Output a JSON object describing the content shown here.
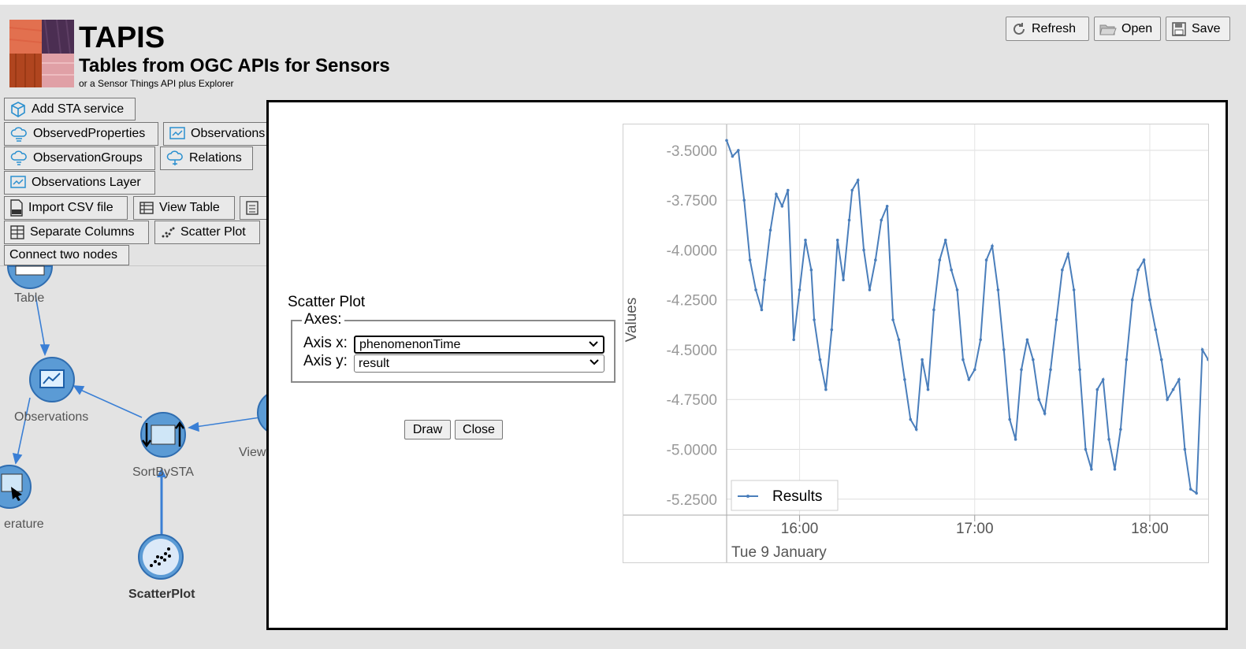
{
  "app": {
    "title": "TAPIS",
    "subtitle": "Tables from OGC APIs for Sensors",
    "tagline": "or a Sensor Things API plus Explorer"
  },
  "header_buttons": [
    {
      "label": "Refresh",
      "icon": "refresh-icon"
    },
    {
      "label": "Open",
      "icon": "folder-open-icon"
    },
    {
      "label": "Save",
      "icon": "floppy-disk-icon"
    }
  ],
  "toolbar": {
    "add_sta": "Add STA service",
    "observed_properties": "ObservedProperties",
    "observations": "Observations",
    "observation_groups": "ObservationGroups",
    "relations": "Relations",
    "observations_layer": "Observations Layer",
    "import_csv": "Import CSV file",
    "view_table": "View Table",
    "separate_columns": "Separate Columns",
    "scatter_plot": "Scatter Plot",
    "connect_nodes": "Connect two nodes"
  },
  "graph": {
    "nodes": [
      {
        "label": "Table"
      },
      {
        "label": "Observations"
      },
      {
        "label": "SortBySTA"
      },
      {
        "label": "View"
      },
      {
        "label": "erature"
      },
      {
        "label": "ScatterPlot"
      }
    ]
  },
  "dialog": {
    "title": "Scatter Plot",
    "axes_legend": "Axes:",
    "axis_x_label": "Axis x:",
    "axis_x_value": "phenomenonTime",
    "axis_y_label": "Axis y:",
    "axis_y_value": "result",
    "draw_label": "Draw",
    "close_label": "Close"
  },
  "chart_data": {
    "type": "line",
    "ylabel": "Values",
    "xlabel": "",
    "x_range": [
      "15:35",
      "18:20"
    ],
    "x_ticks": [
      "16:00",
      "17:00",
      "18:00"
    ],
    "x_sublabel": "Tue 9 January",
    "ylim": [
      -5.33,
      -3.37
    ],
    "y_ticks": [
      -3.5,
      -3.75,
      -4.0,
      -4.25,
      -4.5,
      -4.75,
      -5.0,
      -5.25
    ],
    "y_tick_labels": [
      "-3.5000",
      "-3.7500",
      "-4.0000",
      "-4.2500",
      "-4.5000",
      "-4.7500",
      "-5.0000",
      "-5.2500"
    ],
    "grid": true,
    "legend_position": "bottom-left",
    "series": [
      {
        "name": "Results",
        "color": "#4a7ebb",
        "x": [
          "15:35",
          "15:37",
          "15:39",
          "15:41",
          "15:43",
          "15:45",
          "15:47",
          "15:48",
          "15:50",
          "15:52",
          "15:54",
          "15:56",
          "15:58",
          "16:00",
          "16:02",
          "16:04",
          "16:05",
          "16:07",
          "16:09",
          "16:11",
          "16:13",
          "16:15",
          "16:17",
          "16:18",
          "16:20",
          "16:22",
          "16:24",
          "16:26",
          "16:28",
          "16:30",
          "16:32",
          "16:34",
          "16:36",
          "16:38",
          "16:40",
          "16:42",
          "16:44",
          "16:46",
          "16:48",
          "16:50",
          "16:52",
          "16:54",
          "16:56",
          "16:58",
          "17:00",
          "17:02",
          "17:04",
          "17:06",
          "17:08",
          "17:10",
          "17:12",
          "17:14",
          "17:16",
          "17:18",
          "17:20",
          "17:22",
          "17:24",
          "17:26",
          "17:28",
          "17:30",
          "17:32",
          "17:34",
          "17:36",
          "17:38",
          "17:40",
          "17:42",
          "17:44",
          "17:46",
          "17:48",
          "17:50",
          "17:52",
          "17:54",
          "17:56",
          "17:58",
          "18:00",
          "18:02",
          "18:04",
          "18:06",
          "18:08",
          "18:10",
          "18:12",
          "18:14",
          "18:16",
          "18:18",
          "18:20"
        ],
        "y": [
          -3.45,
          -3.53,
          -3.5,
          -3.75,
          -4.05,
          -4.2,
          -4.3,
          -4.15,
          -3.9,
          -3.72,
          -3.78,
          -3.7,
          -4.45,
          -4.2,
          -3.95,
          -4.1,
          -4.35,
          -4.55,
          -4.7,
          -4.4,
          -3.95,
          -4.15,
          -3.85,
          -3.7,
          -3.65,
          -4.0,
          -4.2,
          -4.05,
          -3.85,
          -3.78,
          -4.35,
          -4.45,
          -4.65,
          -4.85,
          -4.9,
          -4.55,
          -4.7,
          -4.3,
          -4.05,
          -3.95,
          -4.1,
          -4.2,
          -4.55,
          -4.65,
          -4.6,
          -4.45,
          -4.05,
          -3.98,
          -4.2,
          -4.5,
          -4.85,
          -4.95,
          -4.6,
          -4.45,
          -4.55,
          -4.75,
          -4.82,
          -4.6,
          -4.35,
          -4.1,
          -4.02,
          -4.2,
          -4.6,
          -5.0,
          -5.1,
          -4.7,
          -4.65,
          -4.95,
          -5.1,
          -4.9,
          -4.55,
          -4.25,
          -4.1,
          -4.05,
          -4.25,
          -4.4,
          -4.55,
          -4.75,
          -4.7,
          -4.65,
          -5.0,
          -5.2,
          -5.22,
          -4.5,
          -4.55
        ]
      }
    ]
  }
}
